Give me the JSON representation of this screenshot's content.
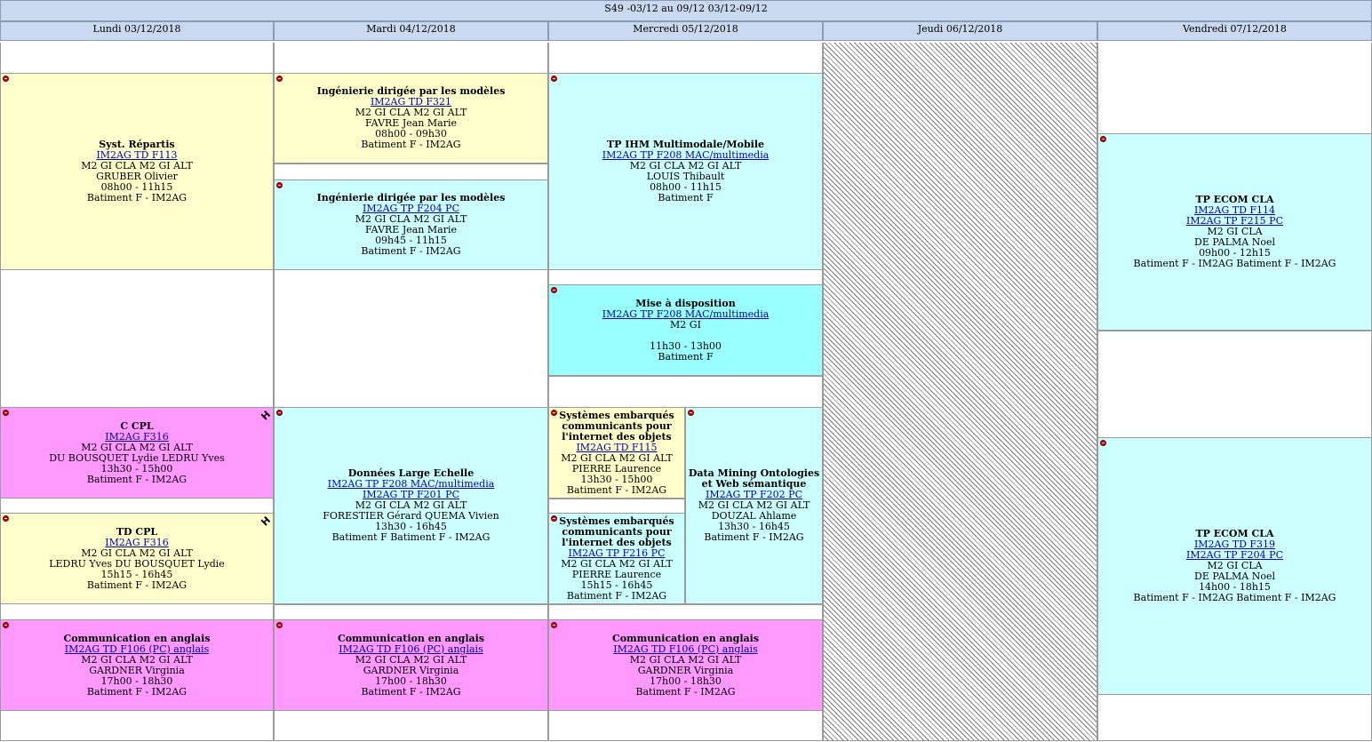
{
  "week": "S49 -03/12 au 09/12 03/12-09/12",
  "days": [
    "Lundi 03/12/2018",
    "Mardi 04/12/2018",
    "Mercredi 05/12/2018",
    "Jeudi 06/12/2018",
    "Vendredi 07/12/2018"
  ],
  "colors": {
    "yellow": "#ffffcc",
    "cyan": "#ccffff",
    "magenta": "#ff99ff",
    "aqua": "#99ffff"
  },
  "events": {
    "e1": {
      "title": "Syst. Répartis",
      "links": [
        "IM2AG TD F113"
      ],
      "lines": [
        "M2 GI CLA M2 GI ALT",
        "GRUBER Olivier",
        "08h00 - 11h15",
        "Batiment F - IM2AG"
      ]
    },
    "e2": {
      "title": "Ingénierie dirigée par les modèles",
      "links": [
        "IM2AG TD F321"
      ],
      "lines": [
        "M2 GI CLA M2 GI ALT",
        "FAVRE Jean Marie",
        "08h00 - 09h30",
        "Batiment F - IM2AG"
      ]
    },
    "e3": {
      "title": "Ingénierie dirigée par les modèles",
      "links": [
        "IM2AG TP F204 PC"
      ],
      "lines": [
        "M2 GI CLA M2 GI ALT",
        "FAVRE Jean Marie",
        "09h45 - 11h15",
        "Batiment F - IM2AG"
      ]
    },
    "e4": {
      "title": "TP IHM Multimodale/Mobile",
      "links": [
        "IM2AG TP F208 MAC/multimedia"
      ],
      "lines": [
        "M2 GI CLA M2 GI ALT",
        "LOUIS Thibault",
        "08h00 - 11h15",
        "Batiment F"
      ]
    },
    "e5": {
      "title": "Mise à disposition",
      "links": [
        "IM2AG TP F208 MAC/multimedia"
      ],
      "lines": [
        "M2 GI",
        "",
        "11h30 - 13h00",
        "Batiment F"
      ]
    },
    "e6": {
      "title": "TP ECOM CLA",
      "links": [
        "IM2AG TD F114",
        "IM2AG TP F215 PC"
      ],
      "lines": [
        "M2 GI CLA",
        "DE PALMA Noel",
        "09h00 - 12h15",
        "Batiment F - IM2AG Batiment F - IM2AG"
      ]
    },
    "e7": {
      "title": "C CPL",
      "links": [
        "IM2AG F316"
      ],
      "lines": [
        "M2 GI CLA M2 GI ALT",
        "DU BOUSQUET Lydie LEDRU Yves",
        "13h30 - 15h00",
        "Batiment F - IM2AG"
      ]
    },
    "e8": {
      "title": "TD CPL",
      "links": [
        "IM2AG F316"
      ],
      "lines": [
        "M2 GI CLA M2 GI ALT",
        "LEDRU Yves DU BOUSQUET Lydie",
        "15h15 - 16h45",
        "Batiment F - IM2AG"
      ]
    },
    "e9": {
      "title": "Données Large Echelle",
      "links": [
        "IM2AG TP F208 MAC/multimedia",
        "IM2AG TP F201 PC"
      ],
      "lines": [
        "M2 GI CLA M2 GI ALT",
        "FORESTIER Gérard QUEMA Vivien",
        "13h30 - 16h45",
        "Batiment F Batiment F - IM2AG"
      ]
    },
    "e10": {
      "title": "Systèmes embarqués communicants pour l'internet des objets",
      "links": [
        "IM2AG TD F115"
      ],
      "lines": [
        "M2 GI CLA M2 GI ALT",
        "PIERRE Laurence",
        "13h30 - 15h00",
        "Batiment F - IM2AG"
      ]
    },
    "e11": {
      "title": "Systèmes embarqués communicants pour l'internet des objets",
      "links": [
        "IM2AG TP F216 PC"
      ],
      "lines": [
        "M2 GI CLA M2 GI ALT",
        "PIERRE Laurence",
        "15h15 - 16h45",
        "Batiment F - IM2AG"
      ]
    },
    "e12": {
      "title": "Data Mining Ontologies et Web sémantique",
      "links": [
        "IM2AG TP F202 PC"
      ],
      "lines": [
        "M2 GI CLA M2 GI ALT",
        "DOUZAL Ahlame",
        "13h30 - 16h45",
        "Batiment F - IM2AG"
      ]
    },
    "e13": {
      "title": "TP ECOM CLA",
      "links": [
        "IM2AG TD F319",
        "IM2AG TP F204 PC"
      ],
      "lines": [
        "M2 GI CLA",
        "DE PALMA Noel",
        "14h00 - 18h15",
        "Batiment F - IM2AG Batiment F - IM2AG"
      ]
    },
    "e14": {
      "title": "Communication en anglais",
      "links": [
        "IM2AG TD F106 (PC) anglais"
      ],
      "lines": [
        "M2 GI CLA M2 GI ALT",
        "GARDNER Virginia",
        "17h00 - 18h30",
        "Batiment F - IM2AG"
      ]
    },
    "e15": {
      "title": "Communication en anglais",
      "links": [
        "IM2AG TD F106 (PC) anglais"
      ],
      "lines": [
        "M2 GI CLA M2 GI ALT",
        "GARDNER Virginia",
        "17h00 - 18h30",
        "Batiment F - IM2AG"
      ]
    },
    "e16": {
      "title": "Communication en anglais",
      "links": [
        "IM2AG TD F106 (PC) anglais"
      ],
      "lines": [
        "M2 GI CLA M2 GI ALT",
        "GARDNER Virginia",
        "17h00 - 18h30",
        "Batiment F - IM2AG"
      ]
    }
  },
  "marks": {
    "h": "H"
  }
}
